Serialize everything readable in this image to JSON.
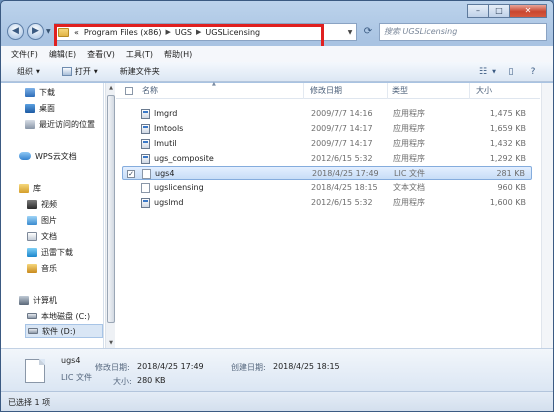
{
  "window": {
    "controls": [
      "–",
      "□",
      "✕"
    ]
  },
  "address": {
    "prefix": "«",
    "segments": [
      "Program Files (x86)",
      "UGS",
      "UGSLicensing"
    ]
  },
  "search": {
    "placeholder": "搜索 UGSLicensing"
  },
  "menu": [
    "文件(F)",
    "编辑(E)",
    "查看(V)",
    "工具(T)",
    "帮助(H)"
  ],
  "toolbar": {
    "organize": "组织",
    "open": "打开",
    "new_folder": "新建文件夹"
  },
  "nav": {
    "downloads": "下载",
    "desktop": "桌面",
    "recent": "最近访问的位置",
    "wps": "WPS云文档",
    "library": "库",
    "videos": "视频",
    "pictures": "图片",
    "documents": "文档",
    "xunlei": "迅雷下载",
    "music": "音乐",
    "computer": "计算机",
    "drive_c": "本地磁盘 (C:)",
    "drive_d": "软件 (D:)"
  },
  "columns": {
    "name": "名称",
    "date": "修改日期",
    "type": "类型",
    "size": "大小"
  },
  "files": [
    {
      "name": "lmgrd",
      "date": "2009/7/7 14:16",
      "type": "应用程序",
      "size": "1,475 KB",
      "icon": "exe"
    },
    {
      "name": "lmtools",
      "date": "2009/7/7 14:17",
      "type": "应用程序",
      "size": "1,659 KB",
      "icon": "exe"
    },
    {
      "name": "lmutil",
      "date": "2009/7/7 14:17",
      "type": "应用程序",
      "size": "1,432 KB",
      "icon": "exe"
    },
    {
      "name": "ugs_composite",
      "date": "2012/6/15 5:32",
      "type": "应用程序",
      "size": "1,292 KB",
      "icon": "exe"
    },
    {
      "name": "ugs4",
      "date": "2018/4/25 17:49",
      "type": "LIC 文件",
      "size": "281 KB",
      "icon": "lic",
      "selected": true
    },
    {
      "name": "ugslicensing",
      "date": "2018/4/25 18:15",
      "type": "文本文档",
      "size": "960 KB",
      "icon": "txt"
    },
    {
      "name": "ugslmd",
      "date": "2012/6/15 5:32",
      "type": "应用程序",
      "size": "1,600 KB",
      "icon": "exe"
    }
  ],
  "details": {
    "name": "ugs4",
    "type": "LIC 文件",
    "modified_label": "修改日期:",
    "modified": "2018/4/25 17:49",
    "created_label": "创建日期:",
    "created": "2018/4/25 18:15",
    "size_label": "大小:",
    "size": "280 KB"
  },
  "status": {
    "text": "已选择 1 项"
  }
}
